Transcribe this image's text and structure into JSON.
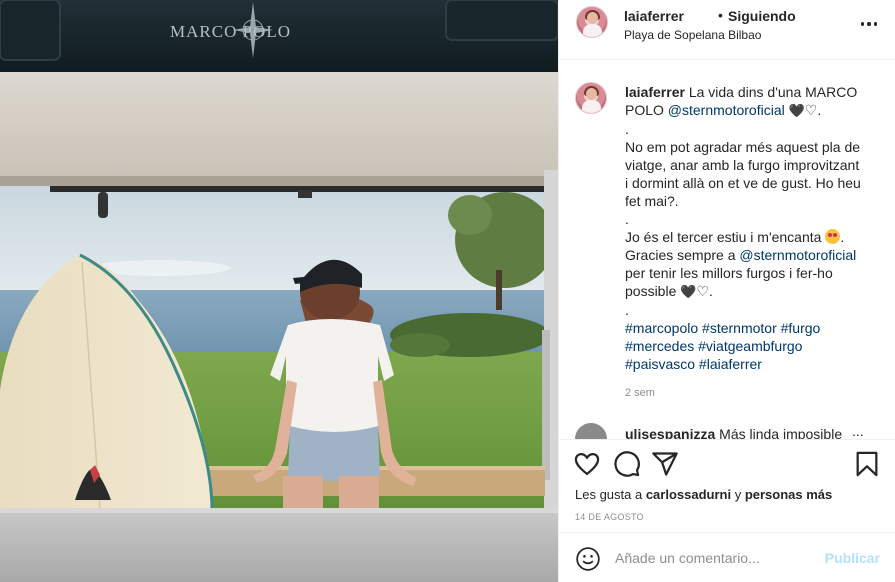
{
  "photo": {
    "brand_text": "MARCO POLO"
  },
  "header": {
    "username": "laiaferrer",
    "separator": "•",
    "follow_status": "Siguiendo",
    "location": "Playa de Sopelana Bilbao"
  },
  "caption": {
    "username": "laiaferrer",
    "line1_text": " La vida dins d'una MARCO POLO ",
    "line1_mention": "@sternmotoroficial",
    "line1_hearts_black": "🖤",
    "line1_hearts_white": "♡",
    "line1_end": ".",
    "dot1": ".",
    "para1": "No em pot agradar més aquest pla de viatge, anar amb la furgo improvitzant i dormint allà on et ve de gust. Ho heu fet mai?.",
    "dot2": ".",
    "para2_start": "Jo és el tercer estiu i m'encanta ",
    "para2_mid": ". Gracies sempre a ",
    "para2_mention": "@sternmotoroficial",
    "para2_end": " per tenir les millors furgos i fer-ho possible ",
    "para2_hearts_black": "🖤",
    "para2_hearts_white": "♡",
    "para2_tail": ".",
    "dot3": ".",
    "hashtags": "#marcopolo #sternmotor #furgo #mercedes #viatgeambfurgo #paisvasco #laiaferrer"
  },
  "time_ago": "2 sem",
  "comment2": {
    "username": "ulisespanizza",
    "text": " Más linda imposible",
    "more": "..."
  },
  "likes": {
    "prefix": "Les gusta a ",
    "user": "carlossadurni",
    "middle": " y ",
    "others": "personas más"
  },
  "date": "14 DE AGOSTO",
  "add_comment": {
    "placeholder": "Añade un comentario...",
    "publish_label": "Publicar"
  },
  "colors": {
    "link": "#00376b",
    "publish_disabled": "#b2dffc",
    "muted": "#8e8e8e"
  }
}
